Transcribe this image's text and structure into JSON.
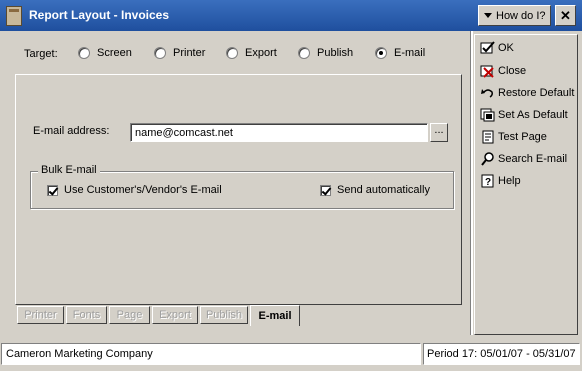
{
  "window": {
    "title": "Report Layout - Invoices",
    "help_label": "How do I?"
  },
  "target": {
    "label": "Target:",
    "options": [
      "Screen",
      "Printer",
      "Export",
      "Publish",
      "E-mail"
    ],
    "selected": "E-mail"
  },
  "email": {
    "label": "E-mail address:",
    "value": "name@comcast.net",
    "browse_label": "..."
  },
  "bulk": {
    "title": "Bulk E-mail",
    "use_customer_label": "Use Customer's/Vendor's E-mail",
    "send_auto_label": "Send automatically"
  },
  "tabs": [
    "Printer",
    "Fonts",
    "Page",
    "Export",
    "Publish",
    "E-mail"
  ],
  "actions": {
    "ok": "OK",
    "close": "Close",
    "restore_default": "Restore Default",
    "set_as_default": "Set As Default",
    "test_page": "Test Page",
    "search_email": "Search E-mail",
    "help": "Help"
  },
  "status": {
    "company": "Cameron Marketing Company",
    "period": "Period 17: 05/01/07 - 05/31/07"
  }
}
